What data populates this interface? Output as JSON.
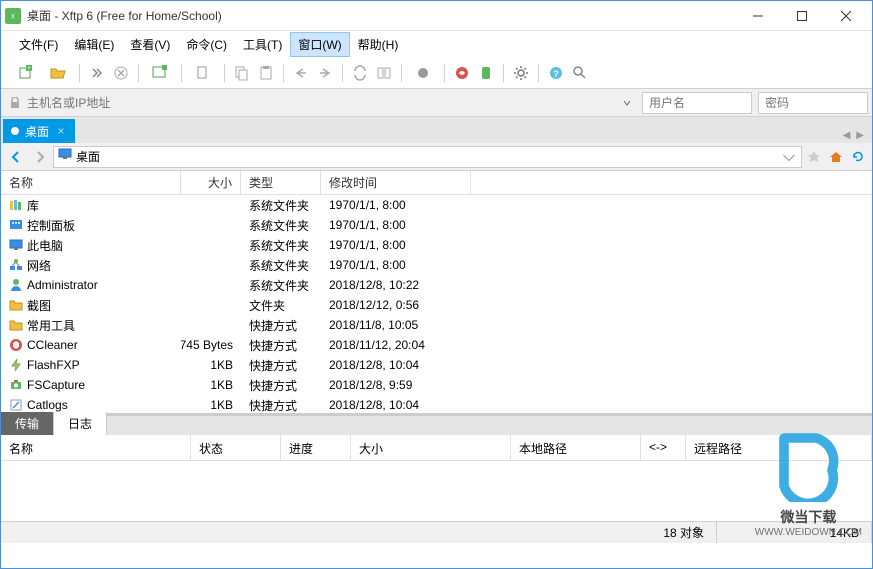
{
  "window": {
    "title": "桌面 - Xftp 6 (Free for Home/School)"
  },
  "menu": {
    "file": "文件(F)",
    "edit": "编辑(E)",
    "view": "查看(V)",
    "command": "命令(C)",
    "tool": "工具(T)",
    "window": "窗口(W)",
    "help": "帮助(H)"
  },
  "address": {
    "host_placeholder": "主机名或IP地址",
    "user_placeholder": "用户名",
    "pass_placeholder": "密码"
  },
  "session_tab": {
    "label": "桌面"
  },
  "path": {
    "value": "桌面"
  },
  "columns": {
    "name": "名称",
    "size": "大小",
    "type": "类型",
    "date": "修改时间"
  },
  "files": [
    {
      "icon": "library",
      "name": "库",
      "size": "",
      "type": "系统文件夹",
      "date": "1970/1/1, 8:00"
    },
    {
      "icon": "control",
      "name": "控制面板",
      "size": "",
      "type": "系统文件夹",
      "date": "1970/1/1, 8:00"
    },
    {
      "icon": "computer",
      "name": "此电脑",
      "size": "",
      "type": "系统文件夹",
      "date": "1970/1/1, 8:00"
    },
    {
      "icon": "network",
      "name": "网络",
      "size": "",
      "type": "系统文件夹",
      "date": "1970/1/1, 8:00"
    },
    {
      "icon": "user",
      "name": "Administrator",
      "size": "",
      "type": "系统文件夹",
      "date": "2018/12/8, 10:22"
    },
    {
      "icon": "folder",
      "name": "截图",
      "size": "",
      "type": "文件夹",
      "date": "2018/12/12, 0:56"
    },
    {
      "icon": "folder",
      "name": "常用工具",
      "size": "",
      "type": "快捷方式",
      "date": "2018/11/8, 10:05"
    },
    {
      "icon": "ccleaner",
      "name": "CCleaner",
      "size": "745 Bytes",
      "type": "快捷方式",
      "date": "2018/11/12, 20:04"
    },
    {
      "icon": "flashfxp",
      "name": "FlashFXP",
      "size": "1KB",
      "type": "快捷方式",
      "date": "2018/12/8, 10:04"
    },
    {
      "icon": "fscapture",
      "name": "FSCapture",
      "size": "1KB",
      "type": "快捷方式",
      "date": "2018/12/8, 9:59"
    },
    {
      "icon": "shortcut",
      "name": "Catlogs",
      "size": "1KB",
      "type": "快捷方式",
      "date": "2018/12/8, 10:04"
    }
  ],
  "bottom_tabs": {
    "transfer": "传输",
    "log": "日志"
  },
  "transfer_cols": {
    "name": "名称",
    "status": "状态",
    "progress": "进度",
    "size": "大小",
    "local": "本地路径",
    "arrow": "<->",
    "remote": "远程路径"
  },
  "status": {
    "objects": "18 对象",
    "total_size": "14KB"
  },
  "watermark": {
    "text1": "微当下载",
    "text2": "WWW.WEIDOWN.COM"
  }
}
